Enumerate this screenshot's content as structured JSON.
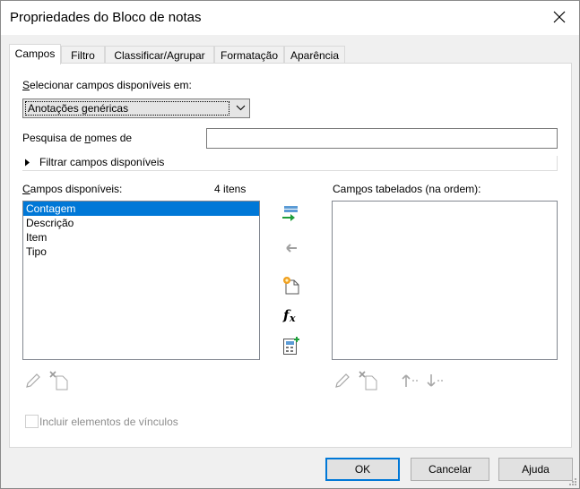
{
  "window": {
    "title": "Propriedades do Bloco de notas"
  },
  "tabs": [
    {
      "label": "Campos",
      "active": true
    },
    {
      "label": "Filtro",
      "active": false
    },
    {
      "label": "Classificar/Agrupar",
      "active": false
    },
    {
      "label": "Formatação",
      "active": false
    },
    {
      "label": "Aparência",
      "active": false
    }
  ],
  "select_fields": {
    "label_mnemonic": "S",
    "label_rest": "elecionar campos disponíveis em:",
    "value": "Anotações genéricas"
  },
  "search": {
    "label_before": "Pesquisa de ",
    "label_mnemonic": "n",
    "label_after": "omes de",
    "value": ""
  },
  "filter_expander": {
    "label": "Filtrar campos disponíveis"
  },
  "available": {
    "label_mnemonic": "C",
    "label_rest": "ampos disponíveis:",
    "count": "4 itens",
    "items": [
      "Contagem",
      "Descrição",
      "Item",
      "Tipo"
    ],
    "selected_index": 0
  },
  "scheduled": {
    "label_before": "Cam",
    "label_mnemonic": "p",
    "label_after": "os tabelados (na ordem):",
    "items": []
  },
  "middle_icons": [
    "add-field-icon",
    "remove-field-icon",
    "new-parameter-icon",
    "calculated-value-icon",
    "combine-parameters-icon"
  ],
  "include_links": {
    "label": "Incluir elementos de vínculos",
    "checked": false,
    "enabled": false
  },
  "buttons": {
    "ok": "OK",
    "cancel": "Cancelar",
    "help": "Ajuda"
  },
  "colors": {
    "selection": "#0078d7",
    "add_arrow": "#1e9e3a",
    "title_bg": "#ffffff"
  }
}
